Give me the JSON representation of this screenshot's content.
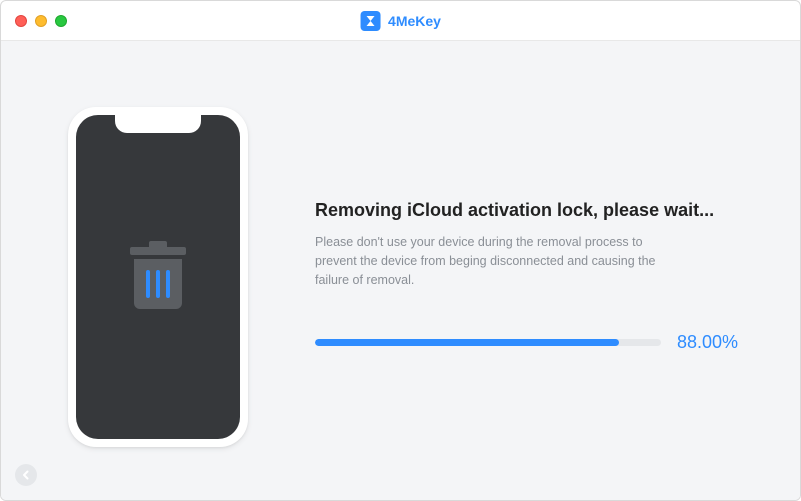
{
  "app": {
    "name": "4MeKey"
  },
  "main": {
    "headline": "Removing iCloud activation lock, please wait...",
    "subtext": "Please don't use your device during the removal process to prevent the device from beging disconnected and causing the failure of removal.",
    "progress": {
      "value": 88.0,
      "label": "88.00%"
    }
  },
  "colors": {
    "accent": "#2e8cff"
  }
}
